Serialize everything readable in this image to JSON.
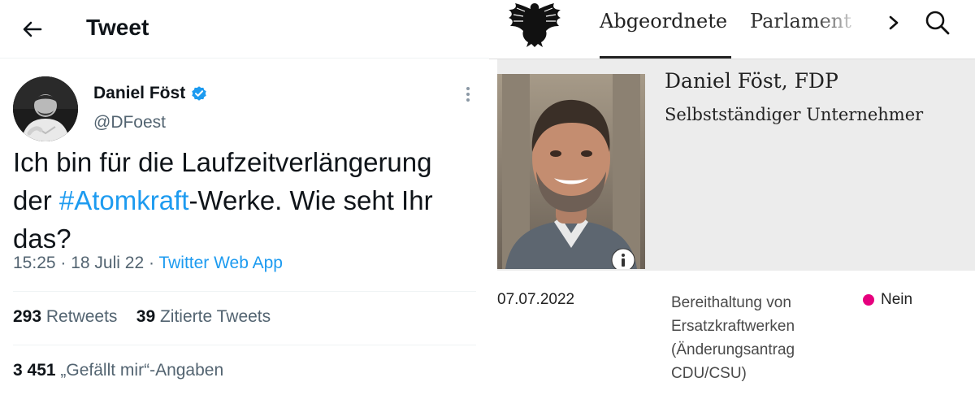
{
  "tweet": {
    "header_title": "Tweet",
    "author_name": "Daniel Föst",
    "author_handle": "@DFoest",
    "text_part1": "Ich bin für die Laufzeitverlängerung der ",
    "hashtag": "#Atomkraft",
    "text_part2": "-Werke. Wie seht Ihr das?",
    "time": "15:25",
    "date": "18 Juli 22",
    "app": "Twitter Web App",
    "retweets_count": "293",
    "retweets_label": "Retweets",
    "quotes_count": "39",
    "quotes_label": "Zitierte Tweets",
    "likes_count": "3 451",
    "likes_label": "„Gefällt mir“-Angaben",
    "colors": {
      "accent": "#1d9bf0",
      "secondary_text": "#536471"
    },
    "icons": [
      "back-arrow-icon",
      "verified-badge-icon",
      "more-vertical-icon"
    ]
  },
  "bundestag": {
    "tabs": [
      "Abgeordnete",
      "Parlament"
    ],
    "active_tab": "Abgeordnete",
    "member_name": "Daniel Föst, FDP",
    "member_job": "Selbstständiger Unternehmer",
    "vote_date": "07.07.2022",
    "vote_topic": "Bereithaltung von Ersatzkraftwerken (Änderungsantrag CDU/CSU)",
    "vote_result": "Nein",
    "colors": {
      "vote_no": "#e6007e"
    },
    "icons": [
      "federal-eagle-icon",
      "chevron-right-icon",
      "search-icon",
      "info-icon"
    ]
  }
}
